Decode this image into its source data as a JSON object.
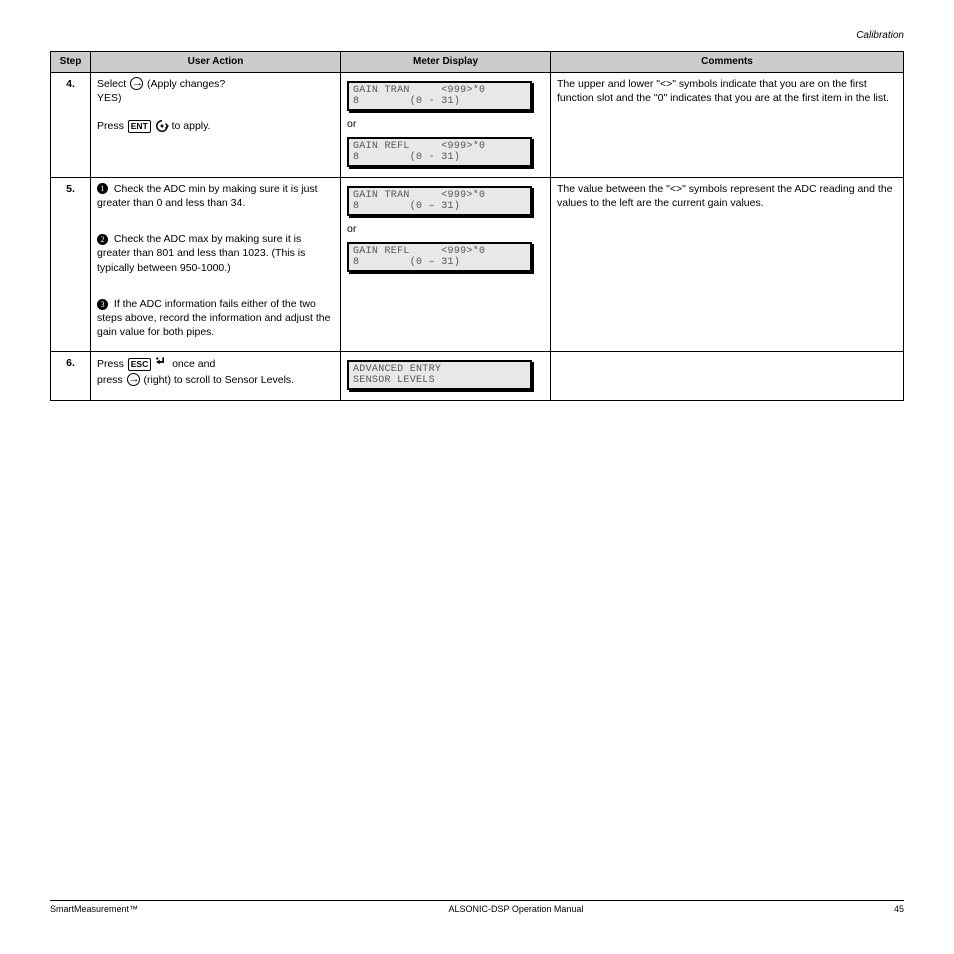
{
  "header": {
    "title": "Calibration"
  },
  "table": {
    "cols": [
      "Step",
      "User Action",
      "Meter Display",
      "Comments"
    ],
    "rows": [
      {
        "step": "4.",
        "user_html": "Select",
        "user_suffix": " (Apply changes?",
        "user_line2": "YES)",
        "user_line3a": "Press ",
        "user_line3b_pill": "ENT",
        "user_line3c": " to apply.",
        "lcd1_l1": "GAIN TRAN     <999>*0",
        "lcd1_l2": "8        (0 - 31)",
        "or": "or",
        "lcd2_l1": "GAIN REFL     <999>*0",
        "lcd2_l2": "8        (0 - 31)",
        "comment": "The upper and lower \"<>\" symbols indicate that you are on the first function slot and the \"0\" indicates that you are at the first item in the list."
      },
      {
        "step": "5.",
        "b1_text": "Check the ADC min by making sure it is just greater than 0 and less than 34.",
        "b2_text": "Check the ADC max by making sure it is greater than 801 and less than 1023. (This is typically between 950-1000.)",
        "b3_text": "If the ADC information fails either of the two steps above, record the information and adjust the gain value for both pipes.",
        "lcd1_l1": "GAIN TRAN     <999>*0",
        "lcd1_l2": "8        (0 – 31)",
        "or": "or",
        "lcd2_l1": "GAIN REFL     <999>*0",
        "lcd2_l2": "8        (0 – 31)",
        "comment": "The value between the \"<>\" symbols represent the ADC reading and the values to the left are the current gain values."
      },
      {
        "step": "6.",
        "user_line1_a": "Press ",
        "user_line1_pill": "ESC",
        "user_line1_b": " once and",
        "user_line2_a": "press ",
        "user_line2_b": " (right) to scroll to Sensor Levels.",
        "lcd_l1": "ADVANCED ENTRY",
        "lcd_l2": "SENSOR LEVELS",
        "comment": ""
      }
    ]
  },
  "footer": {
    "left": "SmartMeasurement™",
    "mid": "ALSONIC-DSP Operation Manual",
    "right": "45"
  }
}
